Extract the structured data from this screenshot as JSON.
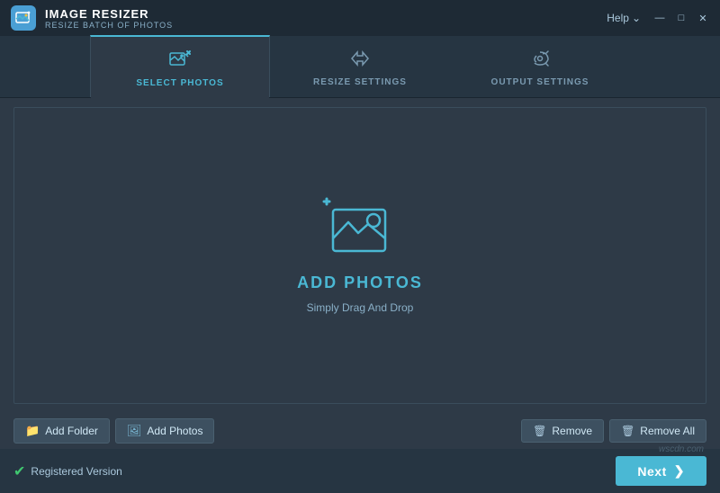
{
  "titleBar": {
    "appTitle": "IMAGE RESIZER",
    "appSubtitle": "RESIZE BATCH OF PHOTOS",
    "helpLabel": "Help",
    "minimizeSymbol": "—",
    "maximizeSymbol": "□",
    "closeSymbol": "✕"
  },
  "tabs": [
    {
      "id": "select",
      "label": "SELECT PHOTOS",
      "active": true
    },
    {
      "id": "resize",
      "label": "RESIZE SETTINGS",
      "active": false
    },
    {
      "id": "output",
      "label": "OUTPUT SETTINGS",
      "active": false
    }
  ],
  "dropZone": {
    "mainLabel": "ADD PHOTOS",
    "subLabel": "Simply Drag And Drop"
  },
  "toolbar": {
    "addFolderLabel": "Add Folder",
    "addPhotosLabel": "Add Photos",
    "removeLabel": "Remove",
    "removeAllLabel": "Remove All"
  },
  "statusBar": {
    "registeredLabel": "Registered Version",
    "nextLabel": "Next"
  },
  "watermark": "wscdn.com"
}
